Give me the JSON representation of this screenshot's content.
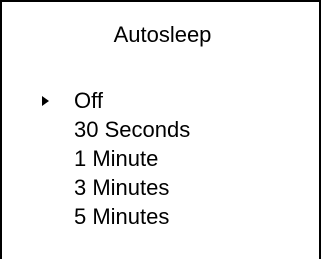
{
  "screen": {
    "title": "Autosleep"
  },
  "menu": {
    "selected_index": 0,
    "cursor_icon": "selection-arrow-icon",
    "items": [
      {
        "label": "Off",
        "selected": true
      },
      {
        "label": "30 Seconds",
        "selected": false
      },
      {
        "label": "1 Minute",
        "selected": false
      },
      {
        "label": "3 Minutes",
        "selected": false
      },
      {
        "label": "5 Minutes",
        "selected": false
      }
    ]
  }
}
